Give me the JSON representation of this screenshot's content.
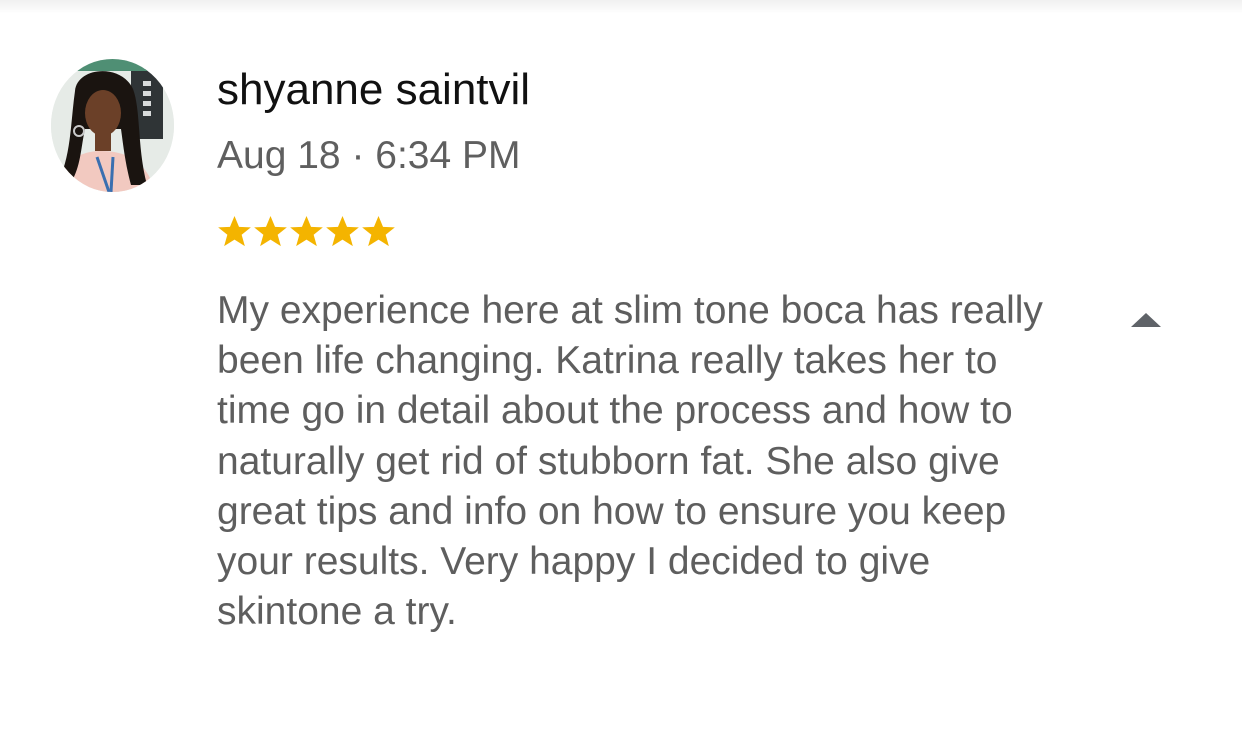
{
  "review": {
    "reviewer_name": "shyanne saintvil",
    "date": "Aug 18 · 6:34 PM",
    "rating": 5,
    "rating_max": 5,
    "text": "My experience here at slim tone boca has really been life changing. Katrina really takes her to time go in detail about the process and how to naturally get rid of stubborn fat. She also give great tips and info on how to ensure you keep your results. Very happy I decided to give skintone a try."
  },
  "icons": {
    "star": "star-icon",
    "collapse": "caret-up-icon",
    "avatar": "avatar-photo"
  },
  "colors": {
    "star": "#f4b400",
    "name": "#111111",
    "meta": "#5f5f5f",
    "body": "#5e5e5e",
    "caret": "#5f6368"
  }
}
